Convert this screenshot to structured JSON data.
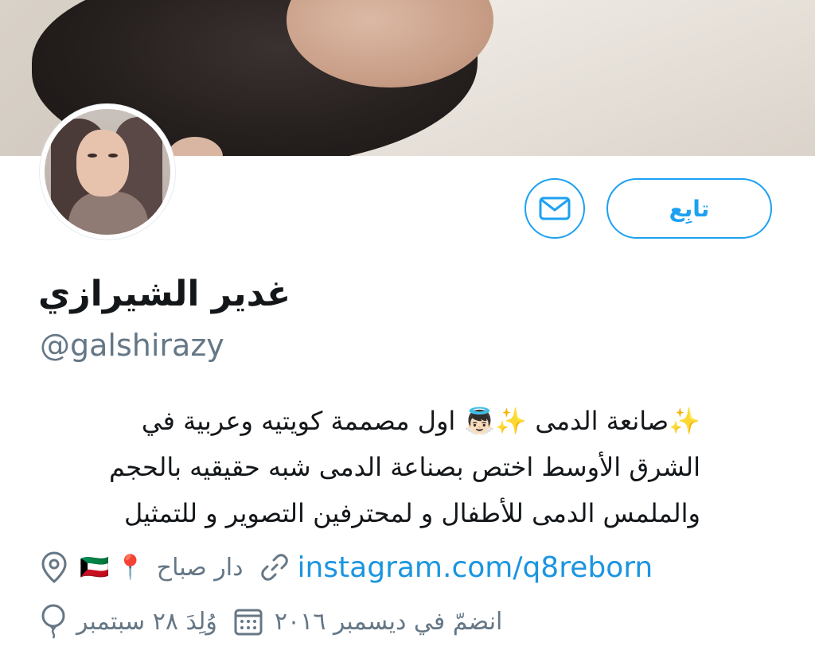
{
  "profile": {
    "name": "غدير الشيرازي",
    "handle": "@galshirazy",
    "bio_lines": [
      "✨صانعة الدمى ✨👼🏻 اول مصممة كويتيه وعربية في",
      "الشرق الأوسط اختص بصناعة الدمى شبه حقيقيه بالحجم",
      "والملمس الدمى للأطفال و لمحترفين التصوير و للتمثيل"
    ],
    "location_text": "دار صباح",
    "location_emoji": "📍",
    "flag_emoji": "🇰🇼",
    "website": "instagram.com/q8reborn",
    "birthday": "وُلِدَ ٢٨ سبتمبر",
    "joined": "انضمّ في ديسمبر ٢٠١٦"
  },
  "buttons": {
    "follow_label": "تابِع"
  },
  "icons": {
    "message": "envelope-icon",
    "location": "map-pin-icon",
    "link": "link-icon",
    "calendar": "calendar-icon",
    "birthday": "balloon-icon"
  },
  "colors": {
    "accent": "#1da1f2",
    "link": "#1b95e0",
    "secondary_text": "#657786",
    "primary_text": "#14171a"
  }
}
